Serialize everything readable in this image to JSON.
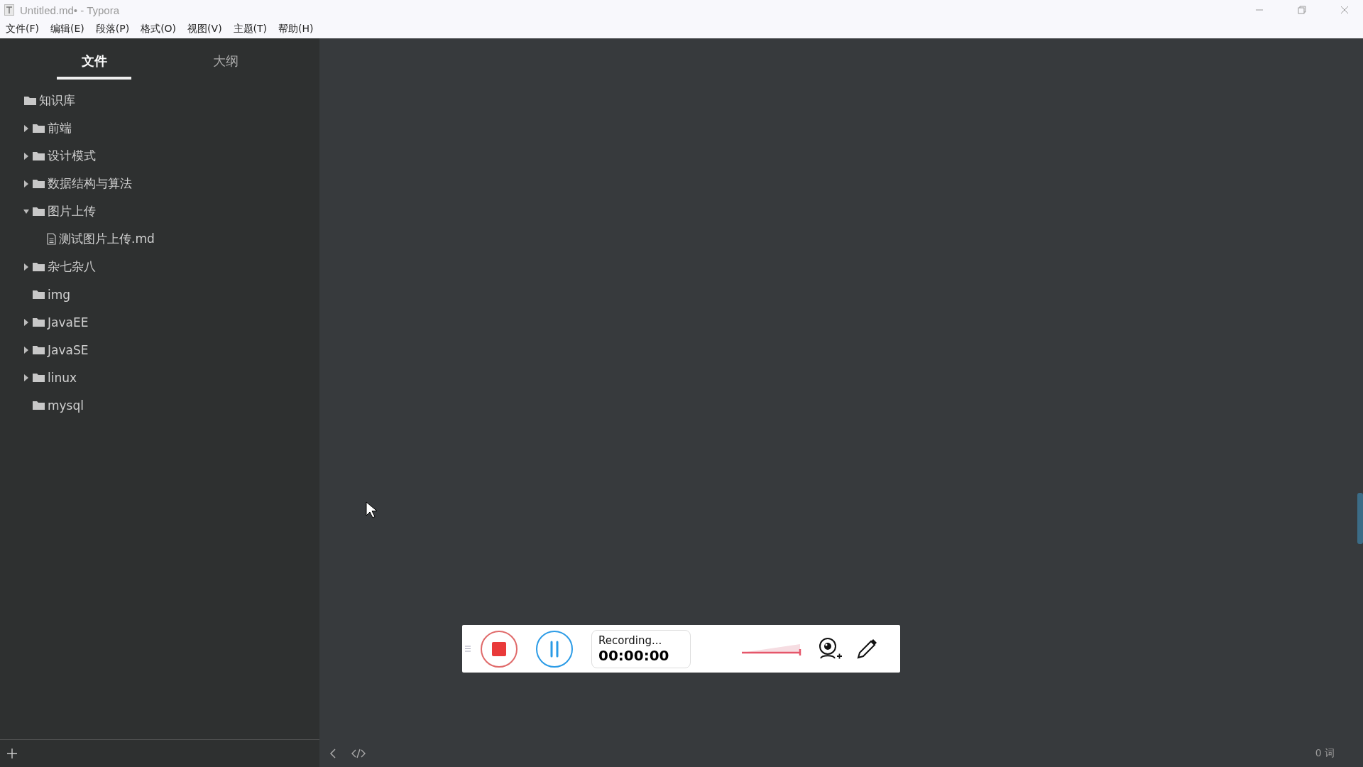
{
  "window": {
    "title": "Untitled.md• - Typora"
  },
  "menu": [
    "文件(F)",
    "编辑(E)",
    "段落(P)",
    "格式(O)",
    "视图(V)",
    "主题(T)",
    "帮助(H)"
  ],
  "sidebar": {
    "tabs": [
      {
        "label": "文件",
        "selected": true
      },
      {
        "label": "大纲",
        "selected": false
      }
    ],
    "tree": [
      {
        "kind": "folder",
        "label": "知识库",
        "children": [
          {
            "kind": "folder",
            "label": "前端",
            "expanded": false
          },
          {
            "kind": "folder",
            "label": "设计模式",
            "expanded": false
          },
          {
            "kind": "folder",
            "label": "数据结构与算法",
            "expanded": false
          },
          {
            "kind": "folder",
            "label": "图片上传",
            "expanded": true,
            "children": [
              {
                "kind": "file",
                "label": "测试图片上传.md"
              }
            ]
          },
          {
            "kind": "folder",
            "label": "杂七杂八",
            "expanded": false
          },
          {
            "kind": "folder",
            "label": "img"
          },
          {
            "kind": "folder",
            "label": "JavaEE",
            "expanded": false
          },
          {
            "kind": "folder",
            "label": "JavaSE",
            "expanded": false
          },
          {
            "kind": "folder",
            "label": "linux",
            "expanded": false
          },
          {
            "kind": "folder",
            "label": "mysql"
          }
        ]
      }
    ]
  },
  "recorder": {
    "status": "Recording...",
    "time": "00:00:00"
  },
  "status_bar": {
    "word_count": "0 词"
  }
}
